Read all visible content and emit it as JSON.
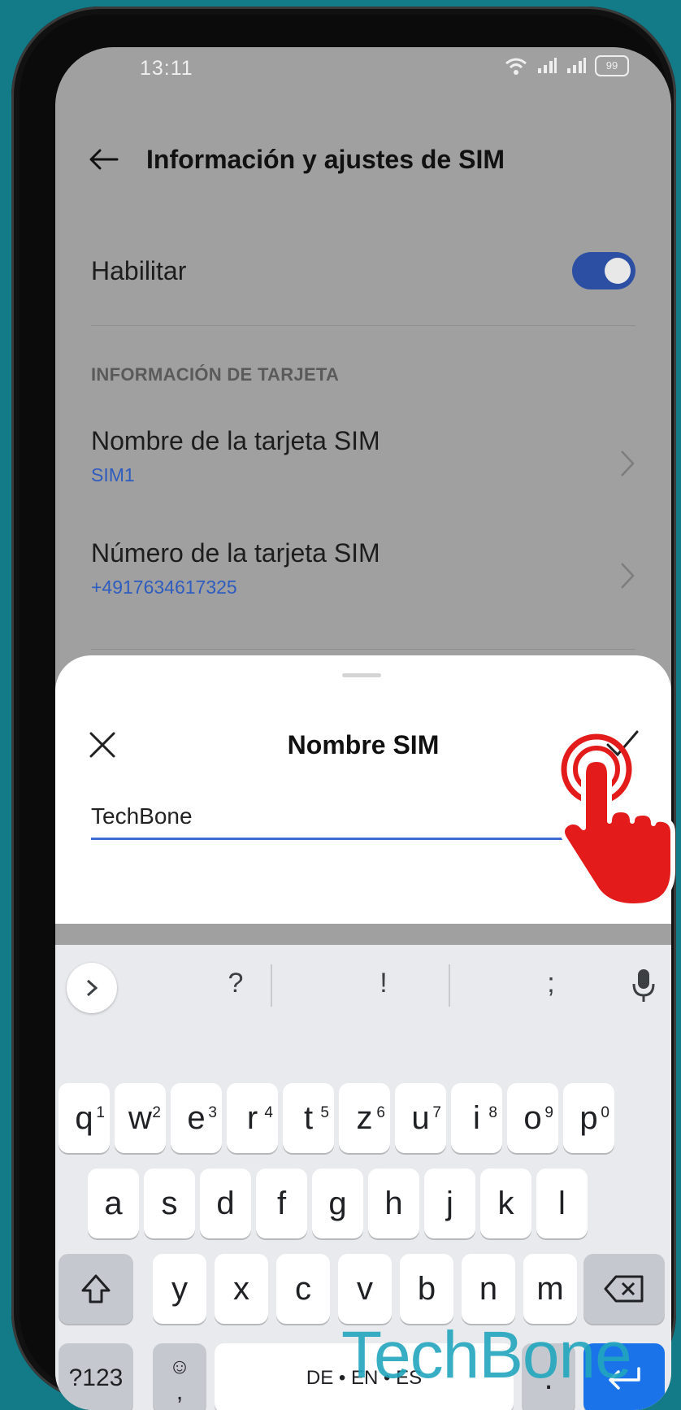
{
  "status": {
    "time": "13:11",
    "battery": "99"
  },
  "header": {
    "title": "Información y ajustes de SIM"
  },
  "enable": {
    "label": "Habilitar",
    "state": "on"
  },
  "section_title": "INFORMACIÓN DE TARJETA",
  "items": [
    {
      "title": "Nombre de la tarjeta SIM",
      "value": "SIM1"
    },
    {
      "title": "Número de la tarjeta SIM",
      "value": "+4917634617325"
    }
  ],
  "sheet": {
    "title": "Nombre SIM",
    "input_value": "TechBone"
  },
  "keyboard": {
    "suggestions": [
      "?",
      "!",
      ";"
    ],
    "row1": [
      {
        "k": "q",
        "h": "1"
      },
      {
        "k": "w",
        "h": "2"
      },
      {
        "k": "e",
        "h": "3"
      },
      {
        "k": "r",
        "h": "4"
      },
      {
        "k": "t",
        "h": "5"
      },
      {
        "k": "z",
        "h": "6"
      },
      {
        "k": "u",
        "h": "7"
      },
      {
        "k": "i",
        "h": "8"
      },
      {
        "k": "o",
        "h": "9"
      },
      {
        "k": "p",
        "h": "0"
      }
    ],
    "row2": [
      "a",
      "s",
      "d",
      "f",
      "g",
      "h",
      "j",
      "k",
      "l"
    ],
    "row3": [
      "y",
      "x",
      "c",
      "v",
      "b",
      "n",
      "m"
    ],
    "sym_label": "?123",
    "comma_label": ",",
    "space_label": "DE • EN • ES",
    "period_label": "."
  },
  "watermark": "TechBone",
  "colors": {
    "accent": "#2c4fa3",
    "link": "#2f5cbf",
    "enter": "#1a73e8",
    "background": "#137a87",
    "tap_icon": "#e31b1b"
  }
}
